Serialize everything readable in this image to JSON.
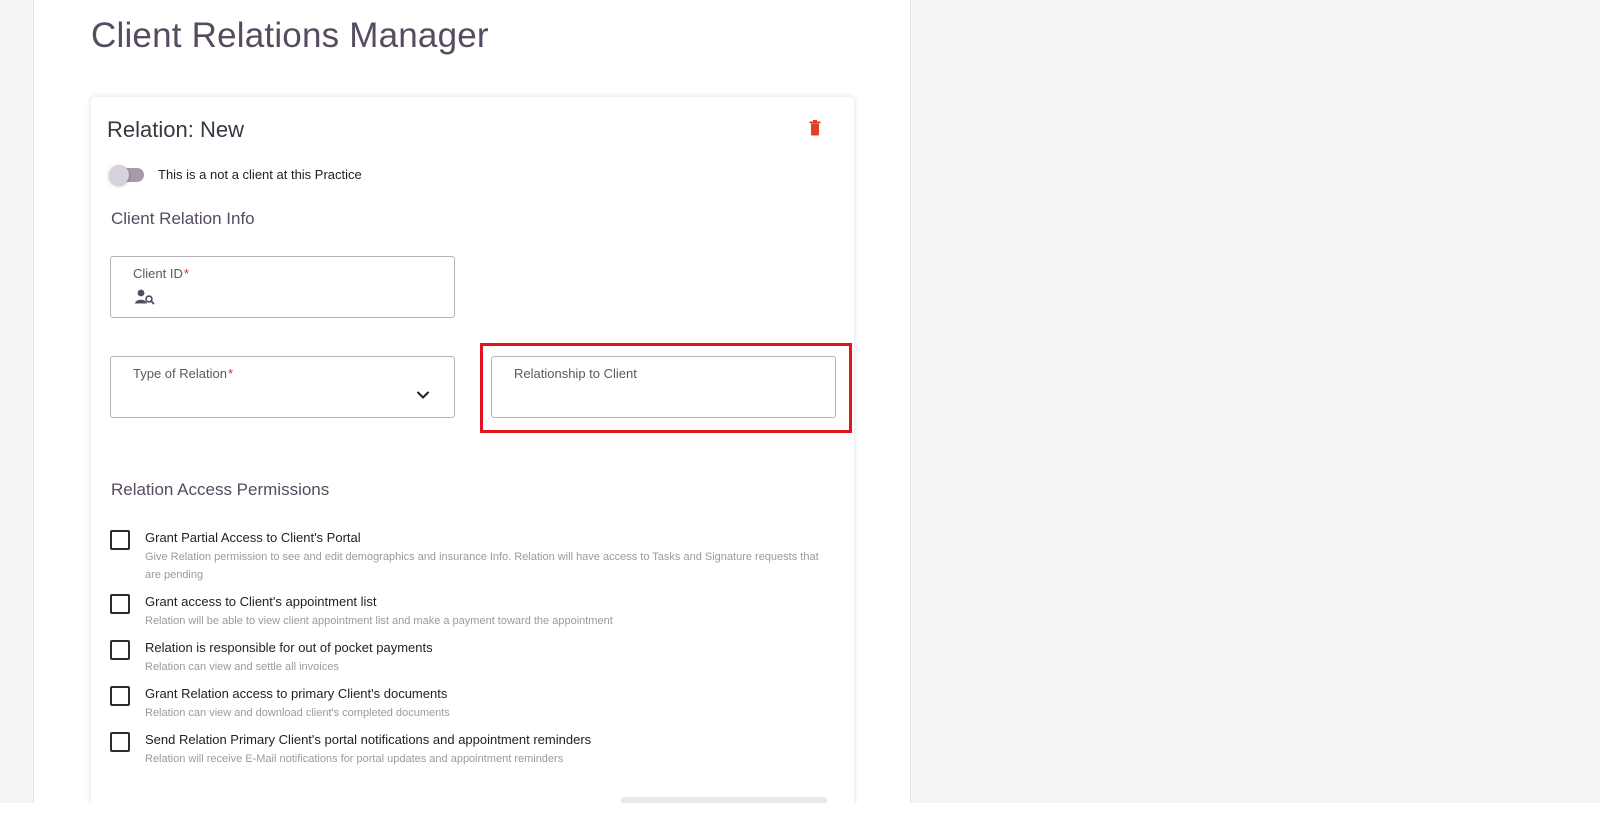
{
  "page": {
    "title": "Client Relations Manager"
  },
  "card": {
    "title": "Relation: New",
    "delete_icon": "trash-icon",
    "toggle_label": "This is a not a client at this Practice"
  },
  "info_section": {
    "title": "Client Relation Info",
    "client_id": {
      "label": "Client ID",
      "required_mark": "*",
      "icon": "person-search-icon",
      "value": ""
    },
    "type_of_relation": {
      "label": "Type of Relation",
      "required_mark": "*",
      "value": "",
      "icon": "chevron-down-icon"
    },
    "relationship_to_client": {
      "label": "Relationship to Client",
      "value": ""
    }
  },
  "permissions": {
    "title": "Relation Access Permissions",
    "items": [
      {
        "title": "Grant Partial Access to Client's Portal",
        "description": "Give Relation permission to see and edit demographics and insurance Info. Relation will have access to Tasks and Signature requests that are pending",
        "checked": false
      },
      {
        "title": "Grant access to Client's appointment list",
        "description": "Relation will be able to view client appointment list and make a payment toward the appointment",
        "checked": false
      },
      {
        "title": "Relation is responsible for out of pocket payments",
        "description": "Relation can view and settle all invoices",
        "checked": false
      },
      {
        "title": "Grant Relation access to primary Client's documents",
        "description": "Relation can view and download client's completed documents",
        "checked": false
      },
      {
        "title": "Send Relation Primary Client's portal notifications and appointment reminders",
        "description": "Relation will receive E-Mail notifications for portal updates and appointment reminders",
        "checked": false
      }
    ]
  },
  "colors": {
    "accent": "#574b5f",
    "required": "#e0243b",
    "delete": "#e0421f",
    "highlight": "#e0131f"
  }
}
